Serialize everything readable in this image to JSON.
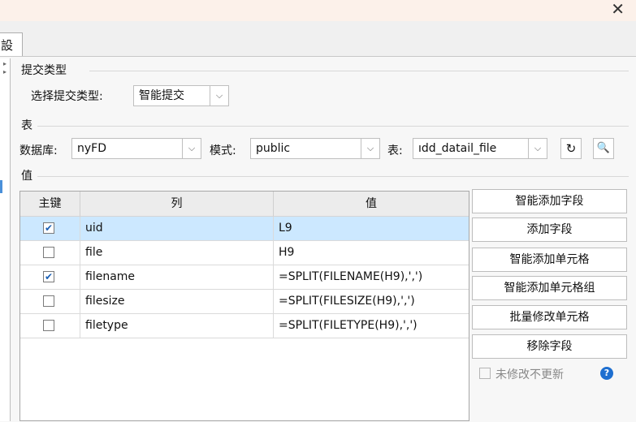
{
  "window": {
    "close_glyph": "✕",
    "tab_label": "設置"
  },
  "submit_type": {
    "section_title": "提交类型",
    "select_label": "选择提交类型:",
    "select_value": "智能提交"
  },
  "table_section": {
    "section_title": "表",
    "db_label": "数据库:",
    "db_value": "nyFD",
    "schema_label": "模式:",
    "schema_value": "public",
    "table_label": "表:",
    "table_value": "ıdd_datail_file"
  },
  "values_section": {
    "section_title": "值",
    "columns": [
      "主键",
      "列",
      "值"
    ],
    "rows": [
      {
        "key": true,
        "column": "uid",
        "value": "L9",
        "selected": true
      },
      {
        "key": false,
        "column": "file",
        "value": "H9",
        "selected": false
      },
      {
        "key": true,
        "column": "filename",
        "value": "=SPLIT(FILENAME(H9),',')",
        "selected": false
      },
      {
        "key": false,
        "column": "filesize",
        "value": "=SPLIT(FILESIZE(H9),',')",
        "selected": false
      },
      {
        "key": false,
        "column": "filetype",
        "value": "=SPLIT(FILETYPE(H9),',')",
        "selected": false
      }
    ]
  },
  "actions": {
    "smart_add_field": "智能添加字段",
    "add_field": "添加字段",
    "smart_add_cell": "智能添加单元格",
    "smart_add_cell_group": "智能添加单元格组",
    "batch_edit_cell": "批量修改单元格",
    "remove_field": "移除字段",
    "no_update_unmodified": "未修改不更新"
  },
  "colors": {
    "accent": "#1e6fd0",
    "selected_row": "#cce8ff",
    "topbar": "#fcf1ea"
  }
}
